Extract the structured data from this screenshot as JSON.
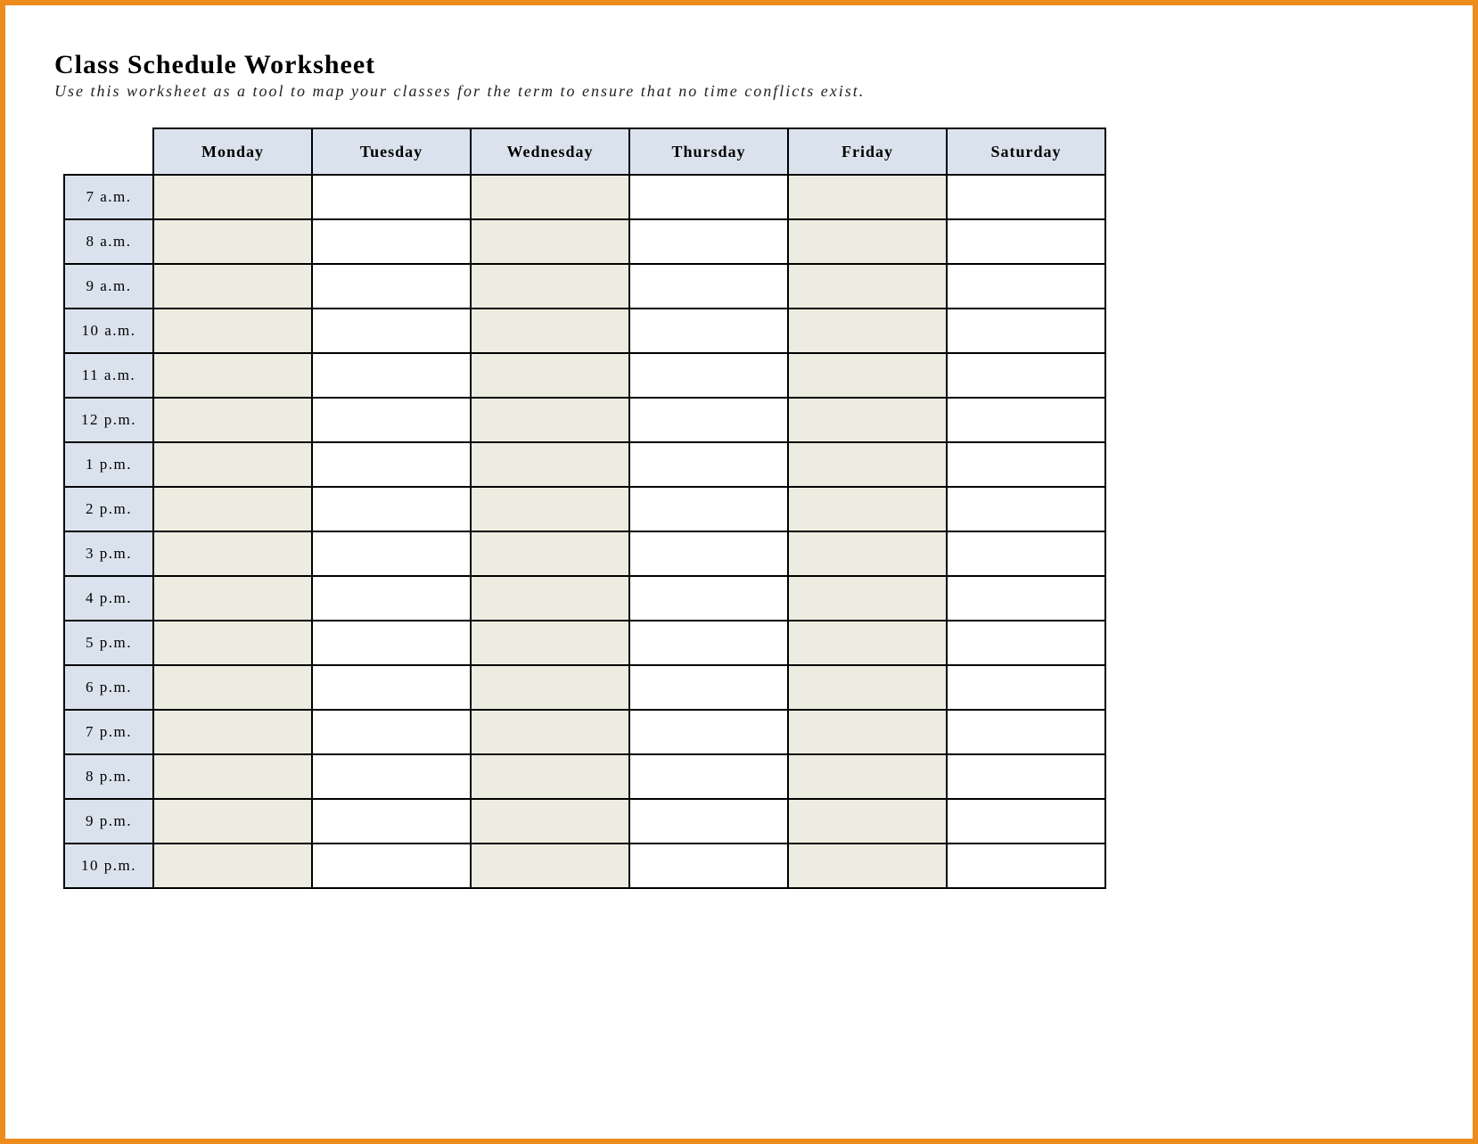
{
  "title": "Class Schedule Worksheet",
  "subtitle": "Use this worksheet as a tool to map your classes for the term to ensure that no time conflicts exist.",
  "days": [
    "Monday",
    "Tuesday",
    "Wednesday",
    "Thursday",
    "Friday",
    "Saturday"
  ],
  "times": [
    "7 a.m.",
    "8 a.m.",
    "9 a.m.",
    "10 a.m.",
    "11 a.m.",
    "12 p.m.",
    "1 p.m.",
    "2 p.m.",
    "3 p.m.",
    "4 p.m.",
    "5 p.m.",
    "6 p.m.",
    "7 p.m.",
    "8 p.m.",
    "9 p.m.",
    "10 p.m."
  ],
  "shaded_columns": [
    0,
    2,
    4
  ]
}
